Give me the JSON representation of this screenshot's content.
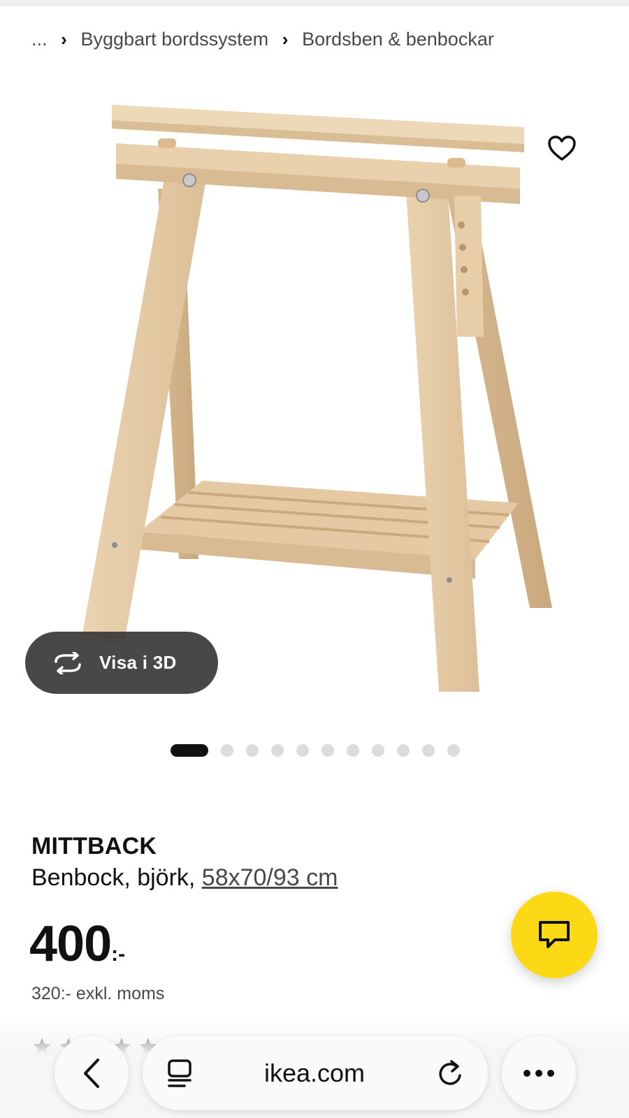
{
  "breadcrumb": {
    "ellipsis": "...",
    "items": [
      {
        "label": "Byggbart bordssystem"
      },
      {
        "label": "Bordsben & benbockar"
      }
    ],
    "separator": "›"
  },
  "gallery": {
    "view3d_label": "Visa i 3D",
    "dot_count": 11,
    "active_index": 0
  },
  "product": {
    "name": "MITTBACK",
    "description": "Benbock, björk, ",
    "size": "58x70/93 cm",
    "price": "400",
    "price_suffix": ":-",
    "price_ex_vat": "320:- exkl. moms",
    "rating_stars": 5
  },
  "browser": {
    "url": "ikea.com"
  },
  "icons": {
    "favorite": "heart-outline-icon",
    "view3d": "rotate-3d-icon",
    "chat": "chat-bubble-icon",
    "back": "chevron-left-icon",
    "tabs": "reader-icon",
    "reload": "reload-icon",
    "more": "more-horizontal-icon",
    "star": "star-icon"
  },
  "colors": {
    "chat_fab": "#fbd914",
    "view3d_bg": "#383838",
    "wood": "#e6cba5"
  }
}
